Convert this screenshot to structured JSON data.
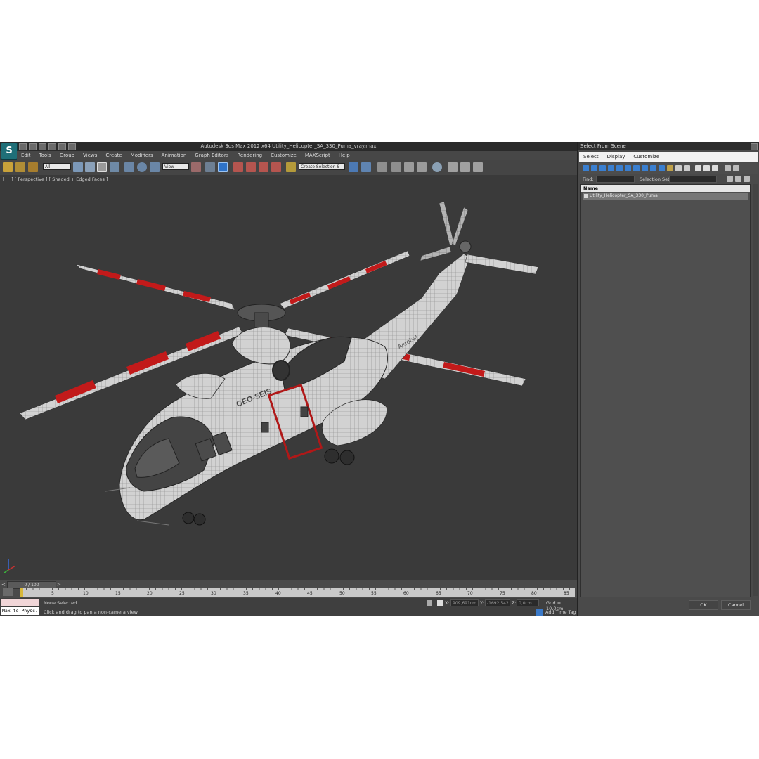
{
  "app": {
    "title": "Autodesk 3ds Max  2012 x64      Utility_Helicopter_SA_330_Puma_vray.max",
    "menu": [
      "Edit",
      "Tools",
      "Group",
      "Views",
      "Create",
      "Modifiers",
      "Animation",
      "Graph Editors",
      "Rendering",
      "Customize",
      "MAXScript",
      "Help"
    ],
    "toolbar": {
      "filter_value": "All",
      "refcoord_value": "View",
      "selection_set_value": "Create Selection S"
    },
    "viewport_label": "[ + ] [ Perspective ] [ Shaded + Edged Faces ]",
    "model_texts": {
      "fuselage_text": "GEO-SEIS",
      "tail_text": "Aerobal"
    }
  },
  "timeline": {
    "frame_slider": "0 / 100",
    "ticks": [
      "5",
      "10",
      "15",
      "20",
      "25",
      "30",
      "35",
      "40",
      "45",
      "50",
      "55",
      "60",
      "65",
      "70",
      "75",
      "80",
      "85"
    ]
  },
  "status": {
    "maxscript_listener": "Max to Physc.",
    "selection": "None Selected",
    "prompt": "Click and drag to pan a non-camera view",
    "x_label": "X:",
    "x_value": "909,691cm",
    "y_label": "Y:",
    "y_value": "-1692,542",
    "z_label": "Z:",
    "z_value": "0,0cm",
    "grid": "Grid = 10,0cm",
    "add_time_tag": "Add Time Tag"
  },
  "dialog": {
    "title": "Select From Scene",
    "menu": [
      "Select",
      "Display",
      "Customize"
    ],
    "find_label": "Find:",
    "selection_set_label": "Selection Set:",
    "column_header": "Name",
    "items": [
      "Utility_Helicopter_SA_330_Puma"
    ],
    "ok_label": "OK",
    "cancel_label": "Cancel"
  }
}
